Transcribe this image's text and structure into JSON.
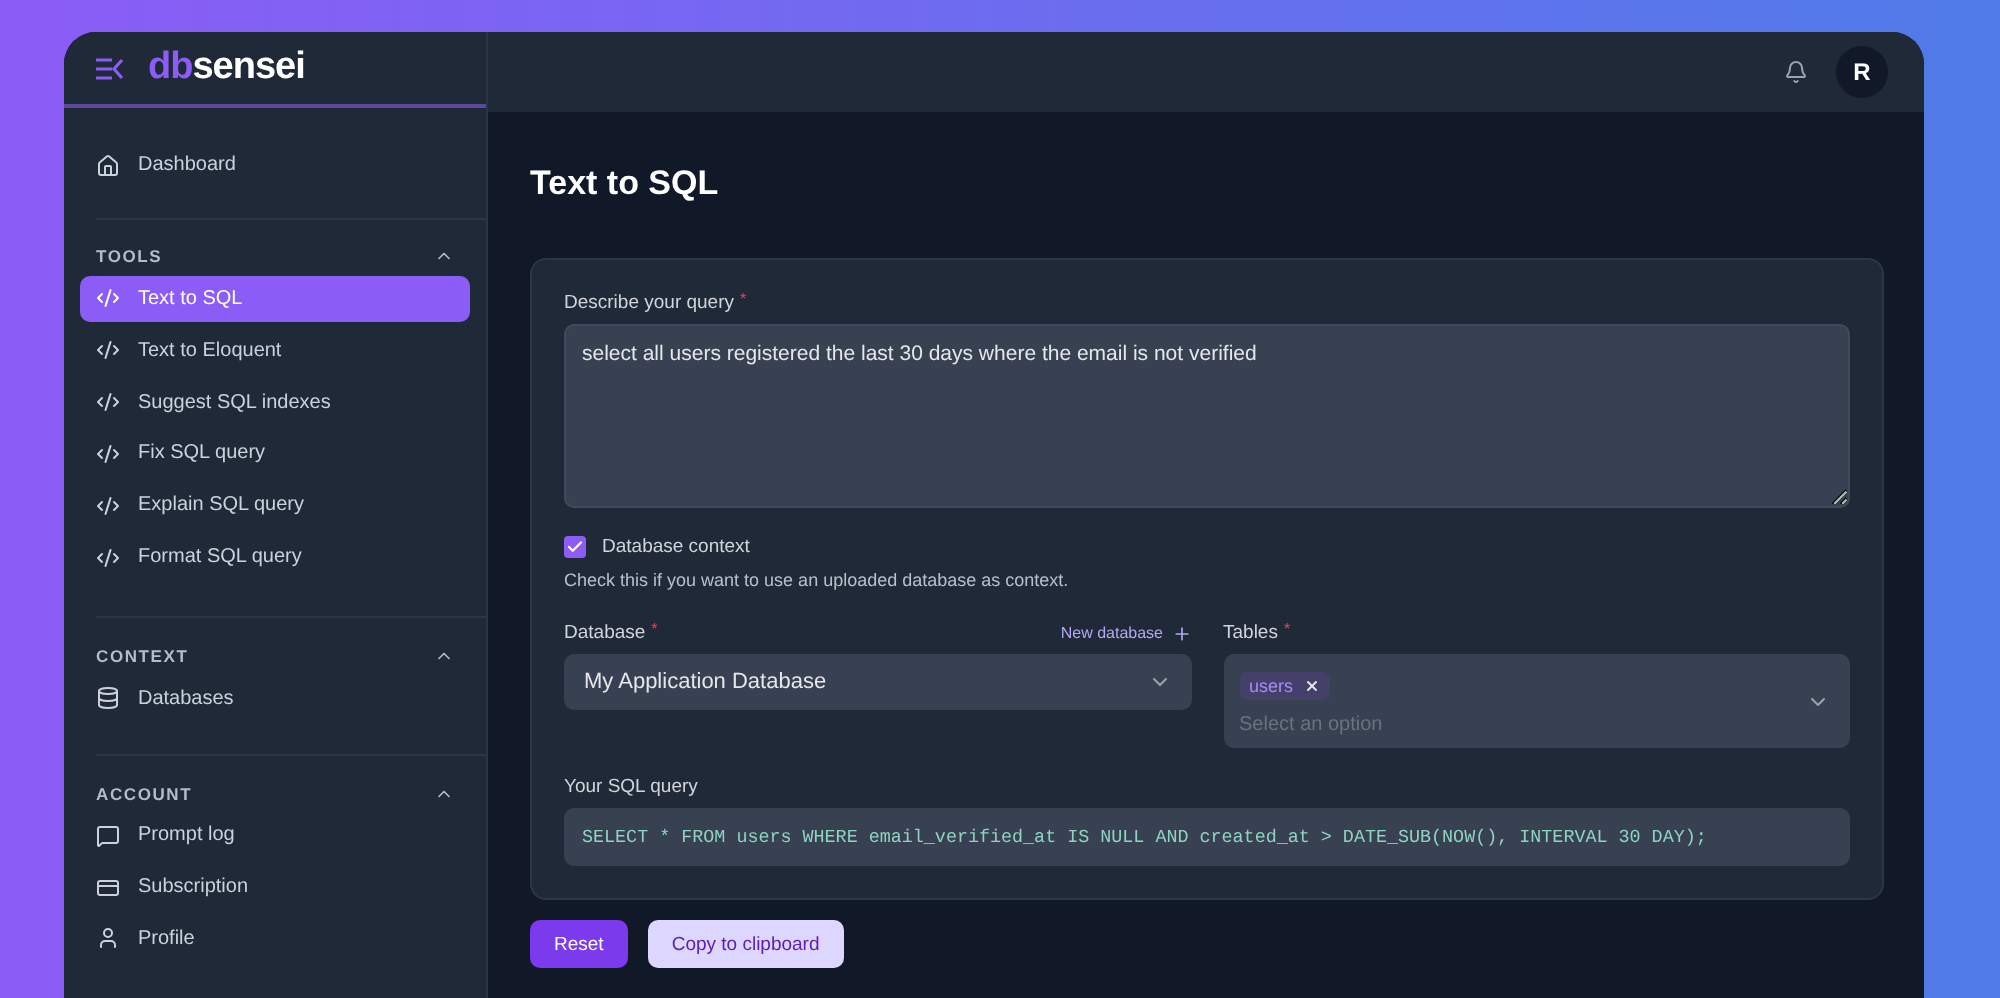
{
  "brand": {
    "part_1": "db",
    "part_2": "sensei"
  },
  "header": {
    "avatar": "R"
  },
  "sidebar": {
    "top_items": [
      {
        "label": "Dashboard",
        "selected": false
      }
    ],
    "sections": [
      {
        "title": "TOOLS",
        "expanded": true,
        "items": [
          {
            "label": "Text to SQL",
            "selected": true
          },
          {
            "label": "Text to Eloquent",
            "selected": false
          },
          {
            "label": "Suggest SQL indexes",
            "selected": false
          },
          {
            "label": "Fix SQL query",
            "selected": false
          },
          {
            "label": "Explain SQL query",
            "selected": false
          },
          {
            "label": "Format SQL query",
            "selected": false
          }
        ]
      },
      {
        "title": "CONTEXT",
        "expanded": true,
        "items": [
          {
            "label": "Databases",
            "selected": false
          }
        ]
      },
      {
        "title": "ACCOUNT",
        "expanded": true,
        "items": [
          {
            "label": "Prompt log",
            "selected": false
          },
          {
            "label": "Subscription",
            "selected": false
          },
          {
            "label": "Profile",
            "selected": false
          }
        ]
      }
    ]
  },
  "page": {
    "title": "Text to SQL"
  },
  "form": {
    "query": {
      "label": "Describe your query",
      "required_mark": "*",
      "value": "select all users registered the last 30 days where the email is not verified"
    },
    "context_checkbox": {
      "label": "Database context",
      "checked": true,
      "help": "Check this if you want to use an uploaded database as context."
    },
    "database": {
      "label": "Database",
      "required_mark": "*",
      "action": "New database",
      "value": "My Application Database"
    },
    "tables": {
      "label": "Tables",
      "required_mark": "*",
      "tags": [
        "users"
      ],
      "placeholder": "Select an option"
    },
    "result": {
      "label": "Your SQL query",
      "value": "SELECT * FROM users WHERE email_verified_at IS NULL AND created_at > DATE_SUB(NOW(), INTERVAL 30 DAY);"
    }
  },
  "buttons": [
    {
      "label": "Reset",
      "kind": "primary"
    },
    {
      "label": "Copy to clipboard",
      "kind": "secondary"
    }
  ]
}
